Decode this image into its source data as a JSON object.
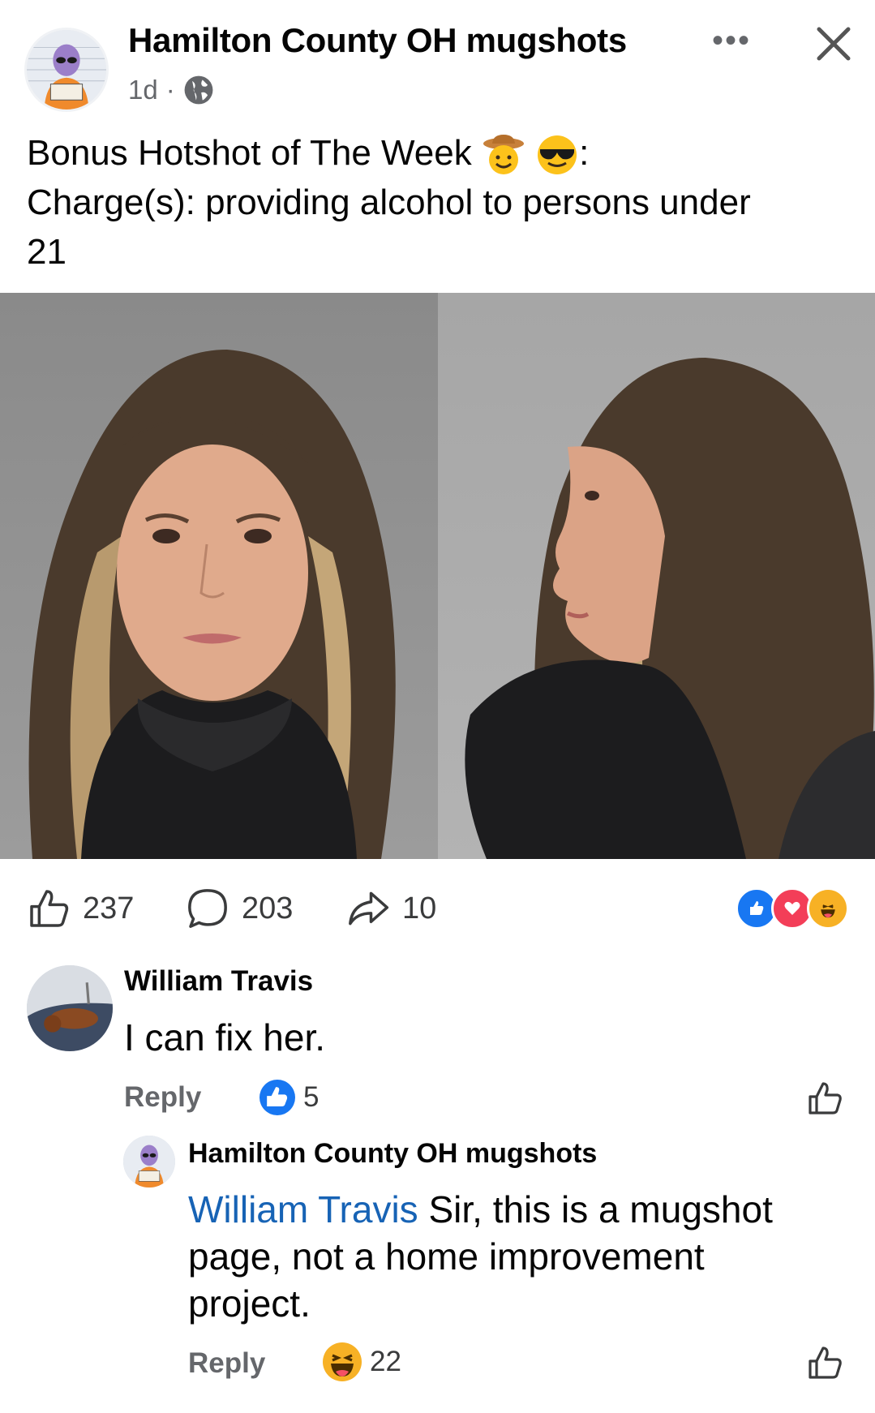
{
  "post": {
    "page_name": "Hamilton County OH mugshots",
    "time": "1d",
    "separator": "·",
    "more": "•••",
    "caption_line1": "Bonus Hotshot of The Week",
    "caption_line1_end": ":",
    "caption_line2": "Charge(s): providing alcohol to persons under",
    "caption_line3": "21",
    "caption_emojis": [
      "cowboy-face",
      "sunglasses-face"
    ]
  },
  "stats": {
    "likes": "237",
    "comments": "203",
    "shares": "10",
    "reaction_icons": [
      "like",
      "love",
      "haha"
    ]
  },
  "comments": [
    {
      "author": "William Travis",
      "text": "I can fix her.",
      "reply_label": "Reply",
      "reaction": "like",
      "reaction_count": "5"
    },
    {
      "author": "Hamilton County OH mugshots",
      "mention": "William Travis",
      "text_line1": " Sir, this is a mugshot",
      "text_line2": "page, not a home improvement",
      "text_line3": "project.",
      "reply_label": "Reply",
      "reaction": "haha",
      "reaction_count": "22"
    }
  ],
  "colors": {
    "accent_blue": "#1877f2",
    "mention_blue": "#1763b5",
    "secondary_text": "#65676b",
    "love_red": "#f33e58",
    "haha_yellow": "#f7b125"
  }
}
